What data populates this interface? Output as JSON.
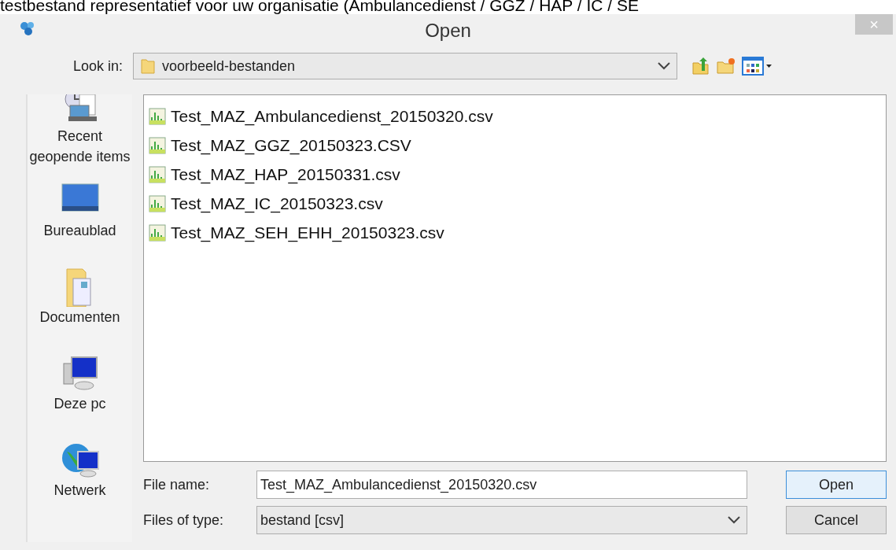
{
  "caption": "testbestand representatief voor uw organisatie (Ambulancedienst / GGZ / HAP / IC / SE",
  "window": {
    "title": "Open",
    "close": "×"
  },
  "look_in": {
    "label": "Look in:",
    "value": "voorbeeld-bestanden"
  },
  "places": [
    {
      "kind": "recent",
      "label": "Recent geopende items"
    },
    {
      "kind": "desktop",
      "label": "Bureaublad"
    },
    {
      "kind": "documents",
      "label": "Documenten"
    },
    {
      "kind": "computer",
      "label": "Deze pc"
    },
    {
      "kind": "network",
      "label": "Netwerk"
    }
  ],
  "files": [
    {
      "name": "Test_MAZ_Ambulancedienst_20150320.csv"
    },
    {
      "name": "Test_MAZ_GGZ_20150323.CSV"
    },
    {
      "name": "Test_MAZ_HAP_20150331.csv"
    },
    {
      "name": "Test_MAZ_IC_20150323.csv"
    },
    {
      "name": "Test_MAZ_SEH_EHH_20150323.csv"
    }
  ],
  "file_name": {
    "label": "File name:",
    "value": "Test_MAZ_Ambulancedienst_20150320.csv"
  },
  "files_of_type": {
    "label": "Files of type:",
    "value": "bestand [csv]"
  },
  "buttons": [
    {
      "label": "Open",
      "default": true
    },
    {
      "label": "Cancel",
      "default": false
    }
  ]
}
